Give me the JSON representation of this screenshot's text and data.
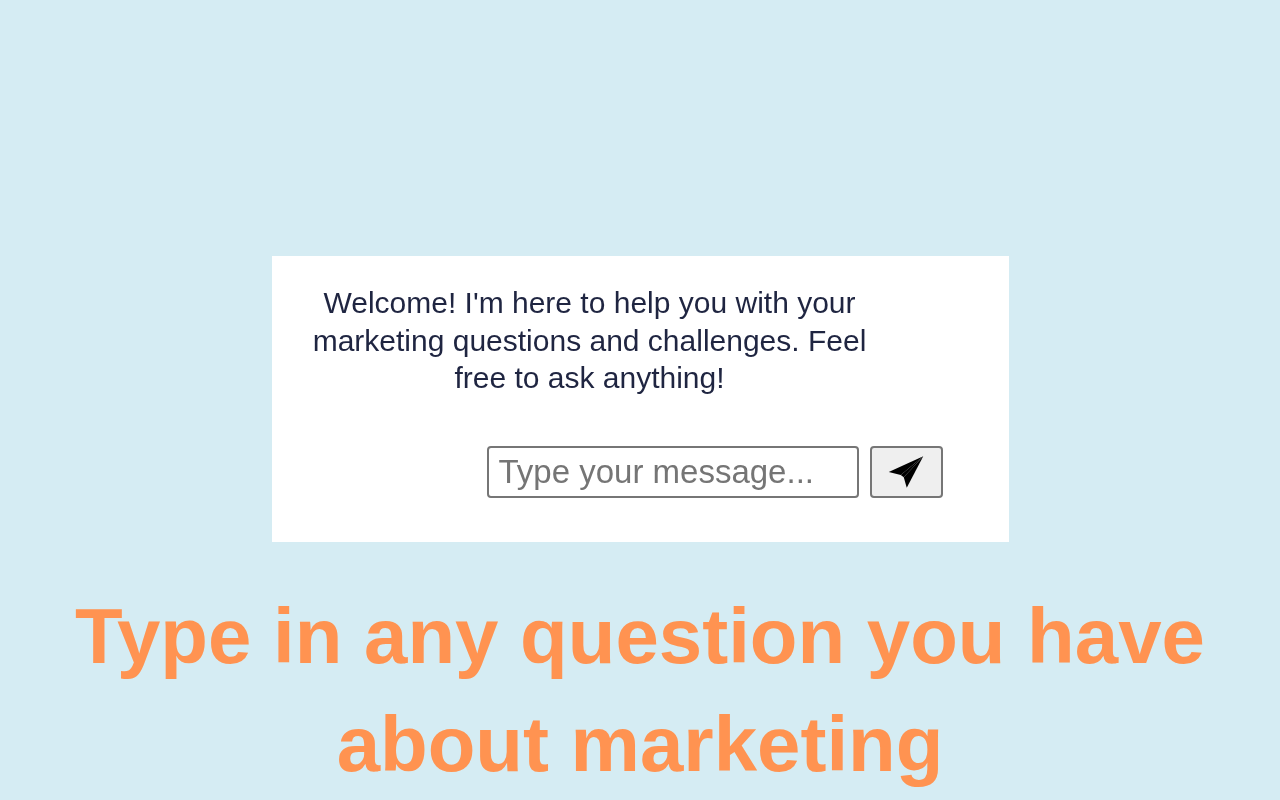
{
  "chat": {
    "welcome_message": "Welcome! I'm here to help you with your marketing questions and challenges. Feel free to ask anything!",
    "input": {
      "placeholder": "Type your message..."
    }
  },
  "caption": "Type in any question you have about marketing"
}
